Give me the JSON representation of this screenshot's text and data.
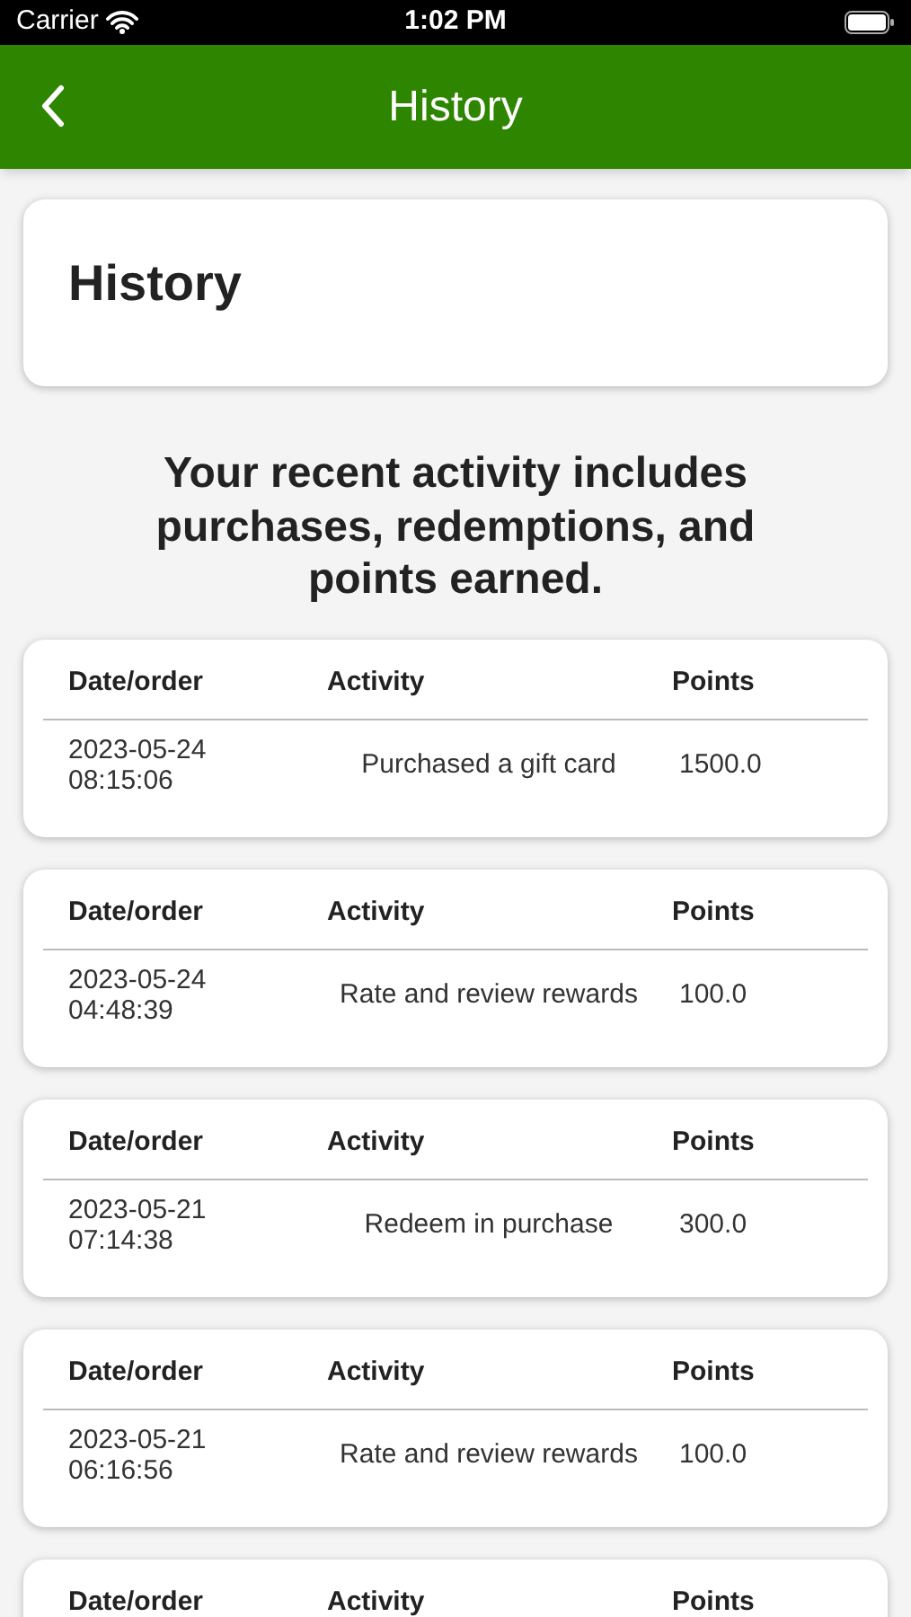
{
  "status_bar": {
    "carrier": "Carrier",
    "time": "1:02 PM"
  },
  "nav_bar": {
    "title": "History"
  },
  "header_card": {
    "title": "History"
  },
  "intro": "Your recent activity includes purchases, redemptions, and points earned.",
  "entries": [
    {
      "columns": [
        "Date/order",
        "Activity",
        "Points"
      ],
      "row": {
        "date": "2023-05-24\n08:15:06",
        "activity": "Purchased a gift card",
        "points": "1500.0"
      }
    },
    {
      "columns": [
        "Date/order",
        "Activity",
        "Points"
      ],
      "row": {
        "date": "2023-05-24\n04:48:39",
        "activity": "Rate and review rewards",
        "points": "100.0"
      }
    },
    {
      "columns": [
        "Date/order",
        "Activity",
        "Points"
      ],
      "row": {
        "date": "2023-05-21\n07:14:38",
        "activity": "Redeem in purchase",
        "points": "300.0"
      }
    },
    {
      "columns": [
        "Date/order",
        "Activity",
        "Points"
      ],
      "row": {
        "date": "2023-05-21\n06:16:56",
        "activity": "Rate and review rewards",
        "points": "100.0"
      }
    },
    {
      "columns": [
        "Date/order",
        "Activity",
        "Points"
      ]
    }
  ]
}
